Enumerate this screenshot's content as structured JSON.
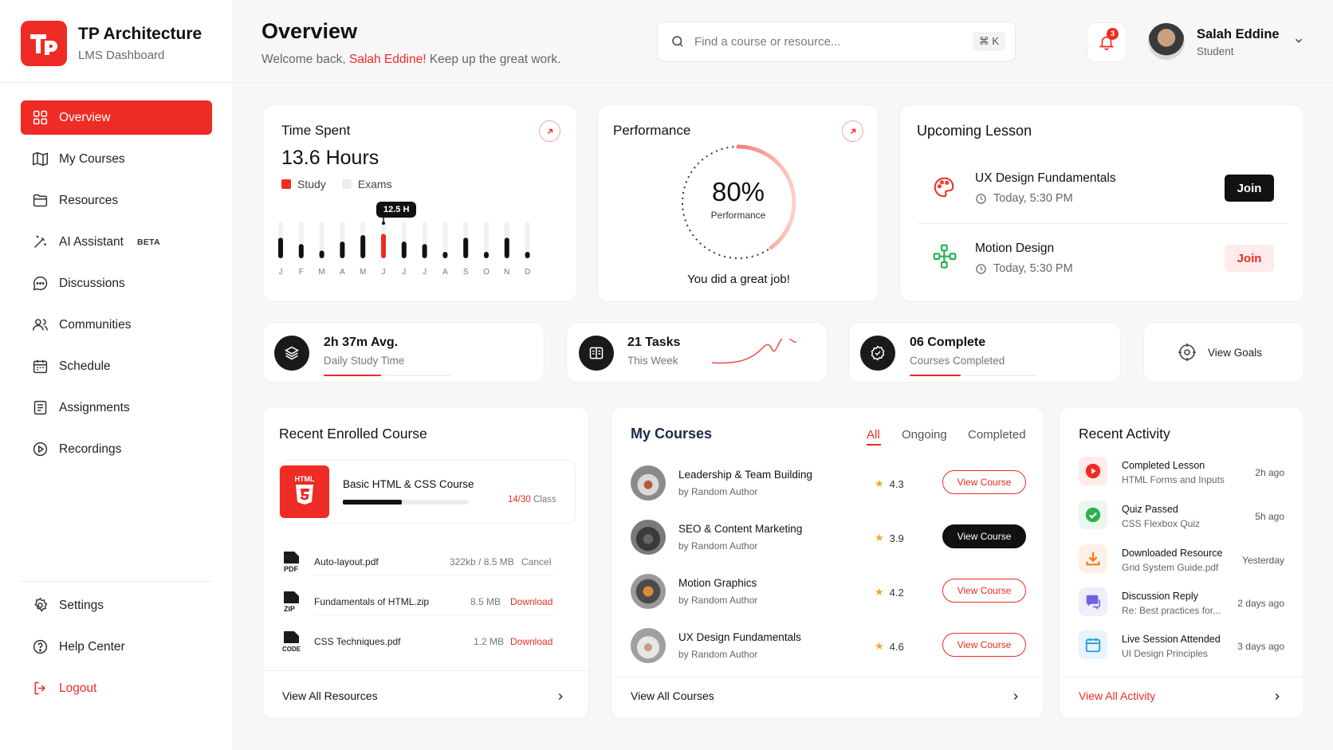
{
  "brand": {
    "title": "TP Architecture",
    "subtitle": "LMS Dashboard",
    "logo_text": "TP"
  },
  "nav": {
    "items": [
      {
        "label": "Overview",
        "icon": "grid-icon"
      },
      {
        "label": "My Courses",
        "icon": "book-open-icon"
      },
      {
        "label": "Resources",
        "icon": "folder-icon"
      },
      {
        "label": "AI Assistant",
        "icon": "magic-wand-icon",
        "badge": "BETA"
      },
      {
        "label": "Discussions",
        "icon": "chat-bubble-icon"
      },
      {
        "label": "Communities",
        "icon": "users-icon"
      },
      {
        "label": "Schedule",
        "icon": "calendar-icon"
      },
      {
        "label": "Assignments",
        "icon": "clipboard-icon"
      },
      {
        "label": "Recordings",
        "icon": "play-circle-icon"
      }
    ],
    "bottom": [
      {
        "label": "Settings",
        "icon": "gear-icon"
      },
      {
        "label": "Help Center",
        "icon": "question-circle-icon"
      },
      {
        "label": "Logout",
        "icon": "logout-icon"
      }
    ]
  },
  "header": {
    "title": "Overview",
    "welcome_prefix": "Welcome back, ",
    "welcome_name": "Salah Eddine!",
    "welcome_suffix": " Keep up the great work."
  },
  "search": {
    "placeholder": "Find a course or resource...",
    "shortcut": "⌘ K"
  },
  "notifications": {
    "count": "3"
  },
  "user": {
    "name": "Salah Eddine",
    "role": "Student"
  },
  "time_spent": {
    "title": "Time Spent",
    "value": "13.6 Hours",
    "legend": [
      "Study",
      "Exams"
    ],
    "tooltip": "12.5 H"
  },
  "chart_data": {
    "type": "bar",
    "categories": [
      "J",
      "F",
      "M",
      "A",
      "M",
      "J",
      "J",
      "J",
      "A",
      "S",
      "O",
      "N",
      "D"
    ],
    "series": [
      {
        "name": "Study",
        "values": [
          0.8,
          0.55,
          0.3,
          0.65,
          0.9,
          0.95,
          0.65,
          0.55,
          0.25,
          0.8,
          0.25,
          0.8,
          0.25
        ]
      },
      {
        "name": "Exams",
        "values": [
          1,
          1,
          1,
          1,
          1,
          1,
          1,
          1,
          1,
          1,
          1,
          1,
          1
        ]
      }
    ],
    "highlight_index": 5,
    "highlight_color": "#ee2b24"
  },
  "performance": {
    "title": "Performance",
    "percent_text": "80%",
    "percent": 80,
    "label": "Performance",
    "message": "You did a great job!"
  },
  "upcoming": {
    "title": "Upcoming Lesson",
    "lessons": [
      {
        "name": "UX Design Fundamentals",
        "time": "Today, 5:30 PM",
        "button": "Join",
        "icon": "palette-icon"
      },
      {
        "name": "Motion Design",
        "time": "Today, 5:30 PM",
        "button": "Join",
        "icon": "vector-nodes-icon"
      }
    ]
  },
  "stats": [
    {
      "main": "2h 37m Avg.",
      "sub": "Daily Study Time",
      "icon": "layers-icon",
      "progress": 0.45
    },
    {
      "main": "21 Tasks",
      "sub": "This Week",
      "icon": "book-icon"
    },
    {
      "main": "06 Complete",
      "sub": "Courses Completed",
      "icon": "check-circle-icon",
      "progress": 0.4
    }
  ],
  "view_goals": {
    "label": "View Goals",
    "icon": "target-icon"
  },
  "recent_course": {
    "title": "Recent Enrolled Course",
    "badge": "HTML",
    "course_name": "Basic HTML & CSS Course",
    "progress_text": "14/30",
    "progress_unit": "Class",
    "progress": 0.47,
    "files": [
      {
        "type": "PDF",
        "name": "Auto-layout.pdf",
        "size": "322kb / 8.5 MB",
        "action": "Cancel"
      },
      {
        "type": "ZIP",
        "name": "Fundamentals of HTML.zip",
        "size": "8.5 MB",
        "action": "Download"
      },
      {
        "type": "CODE",
        "name": "CSS Techniques.pdf",
        "size": "1.2 MB",
        "action": "Download"
      }
    ],
    "view_all": "View All Resources"
  },
  "my_courses": {
    "title": "My Courses",
    "tabs": [
      "All",
      "Ongoing",
      "Completed"
    ],
    "courses": [
      {
        "title": "Leadership & Team Building",
        "author": "by Random Author",
        "rating": "4.3",
        "button": "View Course"
      },
      {
        "title": "SEO & Content Marketing",
        "author": "by Random Author",
        "rating": "3.9",
        "button": "View Course"
      },
      {
        "title": "Motion Graphics",
        "author": "by Random Author",
        "rating": "4.2",
        "button": "View Course"
      },
      {
        "title": "UX Design Fundamentals",
        "author": "by Random Author",
        "rating": "4.6",
        "button": "View Course"
      }
    ],
    "view_all": "View All Courses"
  },
  "activity": {
    "title": "Recent Activity",
    "items": [
      {
        "title": "Completed Lesson",
        "sub": "HTML Forms and Inputs",
        "time": "2h ago",
        "icon": "youtube-play-icon"
      },
      {
        "title": "Quiz Passed",
        "sub": "CSS Flexbox Quiz",
        "time": "5h ago",
        "icon": "check-badge-icon"
      },
      {
        "title": "Downloaded Resource",
        "sub": "Grid System Guide.pdf",
        "time": "Yesterday",
        "icon": "download-icon"
      },
      {
        "title": "Discussion Reply",
        "sub": "Re: Best practices for...",
        "time": "2 days ago",
        "icon": "chat-icon"
      },
      {
        "title": "Live Session Attended",
        "sub": "UI Design Principles",
        "time": "3 days ago",
        "icon": "calendar-icon"
      }
    ],
    "view_all": "View All Activity"
  },
  "colors": {
    "accent": "#ee2b24",
    "dark": "#111111"
  }
}
